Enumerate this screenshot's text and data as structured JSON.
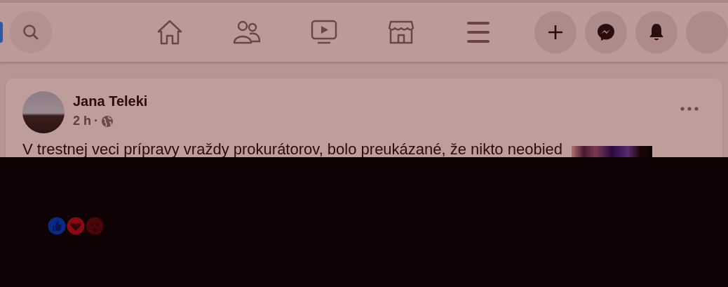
{
  "post": {
    "author": "Jana Teleki",
    "time": "2 h",
    "separator": "·",
    "text": "V trestnej veci prípravy vraždy prokurátorov, bolo preukázané, že nikto neobied"
  }
}
